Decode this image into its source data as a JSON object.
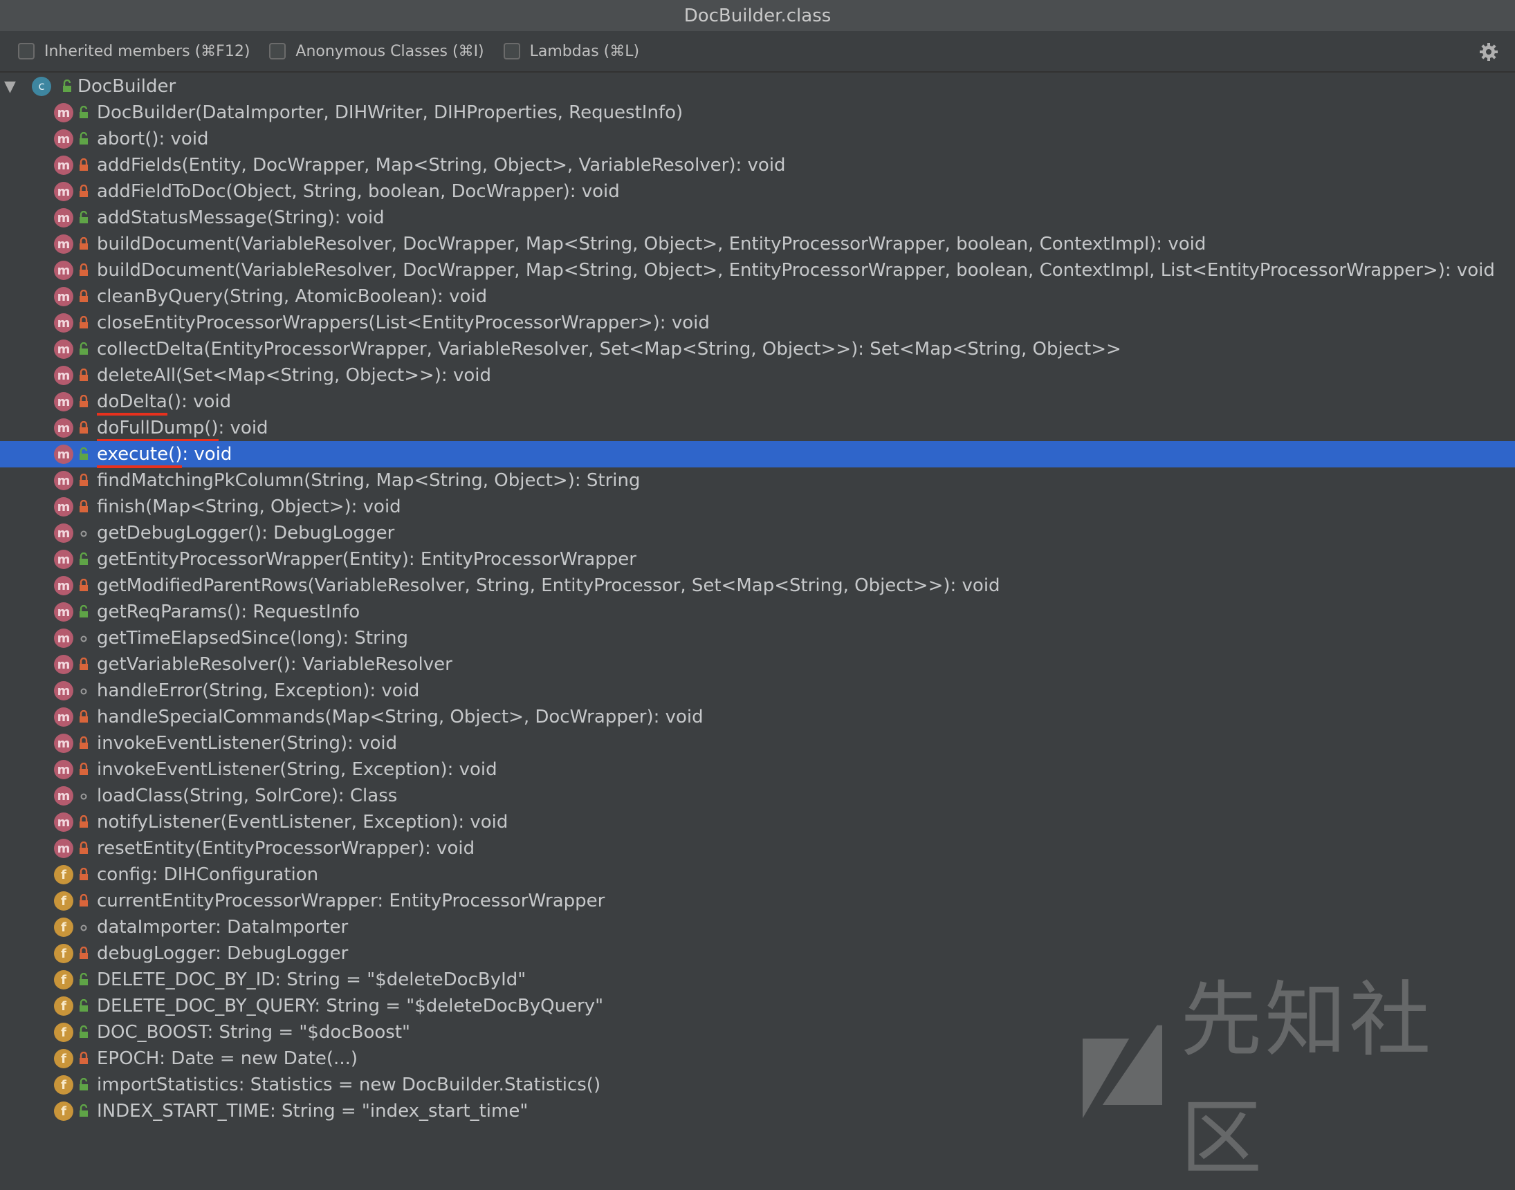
{
  "window": {
    "title": "DocBuilder.class"
  },
  "toolbar": {
    "options": [
      {
        "label": "Inherited members (⌘F12)",
        "checked": false
      },
      {
        "label": "Anonymous Classes (⌘I)",
        "checked": false
      },
      {
        "label": "Lambdas (⌘L)",
        "checked": false
      }
    ],
    "settings_icon": "gear-icon"
  },
  "tree": {
    "root": {
      "label": "DocBuilder",
      "icon": "class-icon",
      "expanded": true
    },
    "members": [
      {
        "kind": "m",
        "vis": "public",
        "label": "DocBuilder(DataImporter, DIHWriter, DIHProperties, RequestInfo)"
      },
      {
        "kind": "m",
        "vis": "public",
        "label": "abort(): void"
      },
      {
        "kind": "m",
        "vis": "private",
        "label": "addFields(Entity, DocWrapper, Map<String, Object>, VariableResolver): void"
      },
      {
        "kind": "m",
        "vis": "private",
        "label": "addFieldToDoc(Object, String, boolean, DocWrapper): void"
      },
      {
        "kind": "m",
        "vis": "public",
        "label": "addStatusMessage(String): void"
      },
      {
        "kind": "m",
        "vis": "private",
        "label": "buildDocument(VariableResolver, DocWrapper, Map<String, Object>, EntityProcessorWrapper, boolean, ContextImpl): void"
      },
      {
        "kind": "m",
        "vis": "private",
        "label": "buildDocument(VariableResolver, DocWrapper, Map<String, Object>, EntityProcessorWrapper, boolean, ContextImpl, List<EntityProcessorWrapper>): void"
      },
      {
        "kind": "m",
        "vis": "private",
        "label": "cleanByQuery(String, AtomicBoolean): void"
      },
      {
        "kind": "m",
        "vis": "private",
        "label": "closeEntityProcessorWrappers(List<EntityProcessorWrapper>): void"
      },
      {
        "kind": "m",
        "vis": "public",
        "label": "collectDelta(EntityProcessorWrapper, VariableResolver, Set<Map<String, Object>>): Set<Map<String, Object>>"
      },
      {
        "kind": "m",
        "vis": "private",
        "label": "deleteAll(Set<Map<String, Object>>): void"
      },
      {
        "kind": "m",
        "vis": "private",
        "label": "doDelta(): void",
        "hl_name": "doDelta",
        "hl_rest": "(): void"
      },
      {
        "kind": "m",
        "vis": "private",
        "label": "doFullDump(): void",
        "hl_name": "doFullDump()",
        "hl_rest": ": void"
      },
      {
        "kind": "m",
        "vis": "public",
        "label": "execute(): void",
        "hl_name": "execute()",
        "hl_rest": ": void",
        "selected": true
      },
      {
        "kind": "m",
        "vis": "private",
        "label": "findMatchingPkColumn(String, Map<String, Object>): String"
      },
      {
        "kind": "m",
        "vis": "private",
        "label": "finish(Map<String, Object>): void"
      },
      {
        "kind": "m",
        "vis": "package",
        "label": "getDebugLogger(): DebugLogger"
      },
      {
        "kind": "m",
        "vis": "public",
        "label": "getEntityProcessorWrapper(Entity): EntityProcessorWrapper"
      },
      {
        "kind": "m",
        "vis": "private",
        "label": "getModifiedParentRows(VariableResolver, String, EntityProcessor, Set<Map<String, Object>>): void"
      },
      {
        "kind": "m",
        "vis": "public",
        "label": "getReqParams(): RequestInfo"
      },
      {
        "kind": "m",
        "vis": "package",
        "label": "getTimeElapsedSince(long): String"
      },
      {
        "kind": "m",
        "vis": "private",
        "label": "getVariableResolver(): VariableResolver"
      },
      {
        "kind": "m",
        "vis": "package",
        "label": "handleError(String, Exception): void"
      },
      {
        "kind": "m",
        "vis": "private",
        "label": "handleSpecialCommands(Map<String, Object>, DocWrapper): void"
      },
      {
        "kind": "m",
        "vis": "private",
        "label": "invokeEventListener(String): void"
      },
      {
        "kind": "m",
        "vis": "private",
        "label": "invokeEventListener(String, Exception): void"
      },
      {
        "kind": "m",
        "vis": "package",
        "label": "loadClass(String, SolrCore): Class"
      },
      {
        "kind": "m",
        "vis": "private",
        "label": "notifyListener(EventListener, Exception): void"
      },
      {
        "kind": "m",
        "vis": "private",
        "label": "resetEntity(EntityProcessorWrapper): void"
      },
      {
        "kind": "f",
        "vis": "private",
        "label": "config: DIHConfiguration"
      },
      {
        "kind": "f",
        "vis": "private",
        "label": "currentEntityProcessorWrapper: EntityProcessorWrapper"
      },
      {
        "kind": "f",
        "vis": "package",
        "label": "dataImporter: DataImporter"
      },
      {
        "kind": "f",
        "vis": "private",
        "label": "debugLogger: DebugLogger"
      },
      {
        "kind": "f",
        "vis": "public",
        "label": "DELETE_DOC_BY_ID: String = \"$deleteDocById\""
      },
      {
        "kind": "f",
        "vis": "public",
        "label": "DELETE_DOC_BY_QUERY: String = \"$deleteDocByQuery\""
      },
      {
        "kind": "f",
        "vis": "public",
        "label": "DOC_BOOST: String = \"$docBoost\""
      },
      {
        "kind": "f",
        "vis": "private",
        "label": "EPOCH: Date = new Date(...)"
      },
      {
        "kind": "f",
        "vis": "public",
        "label": "importStatistics: Statistics = new DocBuilder.Statistics()"
      },
      {
        "kind": "f",
        "vis": "public",
        "label": "INDEX_START_TIME: String = \"index_start_time\""
      }
    ]
  },
  "watermark": {
    "text": "先知社区"
  },
  "colors": {
    "background": "#3c3f41",
    "selection": "#2f65ca",
    "method_icon": "#b55b6e",
    "field_icon": "#c9953a",
    "class_icon": "#3e86a0",
    "public_vis": "#5fa447",
    "private_vis": "#d9653b",
    "underline": "#e8311d"
  }
}
